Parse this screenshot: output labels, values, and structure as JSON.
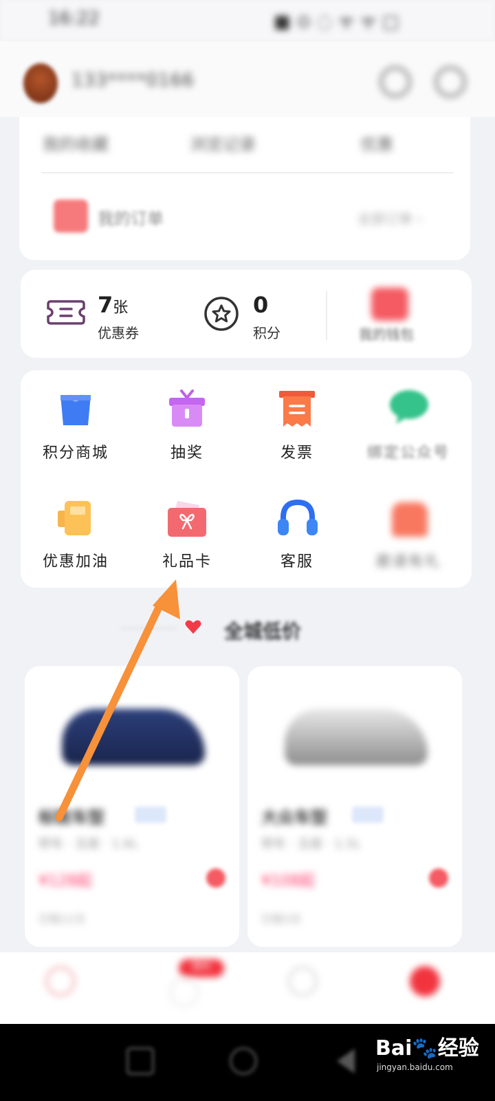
{
  "status_bar": {
    "time": "16:22",
    "right": "■ ⊙ ◌ ᯤ ᯤ □"
  },
  "header": {
    "username": "133****0166"
  },
  "top_links": [
    "我的收藏",
    "浏览记录",
    "优惠"
  ],
  "order": {
    "label": "我的订单",
    "right_label": "全部订单 ›"
  },
  "stats": {
    "coupons": {
      "count": "7",
      "unit": "张",
      "label": "优惠券"
    },
    "points": {
      "count": "0",
      "label": "积分"
    },
    "wallet": {
      "label": "我的钱包"
    }
  },
  "grid": [
    {
      "label": "积分商城",
      "icon": "shopping-bag-icon"
    },
    {
      "label": "抽奖",
      "icon": "gift-box-icon"
    },
    {
      "label": "发票",
      "icon": "invoice-icon"
    },
    {
      "label": "绑定公众号",
      "icon": "chat-bubble-icon"
    },
    {
      "label": "优惠加油",
      "icon": "fuel-pump-icon"
    },
    {
      "label": "礼品卡",
      "icon": "gift-card-icon"
    },
    {
      "label": "客服",
      "icon": "headset-icon"
    },
    {
      "label": "邀请有礼",
      "icon": "invite-icon"
    }
  ],
  "section": {
    "title": "全城低价"
  },
  "products": [
    {
      "name": "标致车型",
      "spec": "轿车 · 五座 · 1.6L",
      "price": "¥128起",
      "foot": "已租12次"
    },
    {
      "name": "大众车型",
      "spec": "轿车 · 五座 · 1.5L",
      "price": "¥108起",
      "foot": "已租3次"
    }
  ],
  "tabbar": {
    "badge": "限时"
  },
  "watermark": {
    "brand": "Bai",
    "cn": "经验",
    "url": "jingyan.baidu.com"
  },
  "colors": {
    "accent": "#f45b62",
    "arrow": "#f7913a",
    "coupon_icon": "#6b3e6e"
  }
}
